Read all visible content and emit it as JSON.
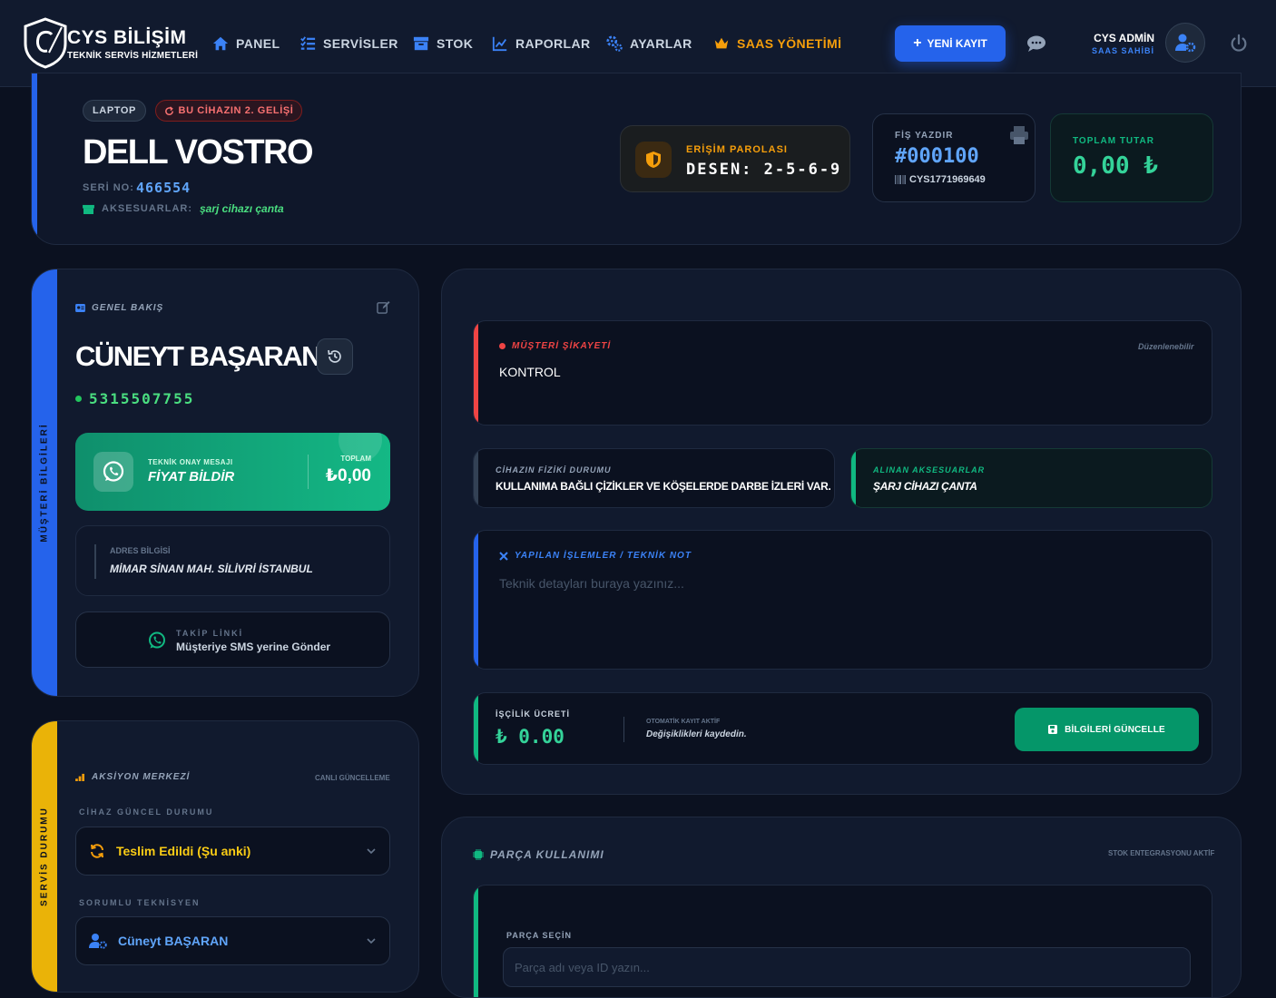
{
  "colors": {
    "primary": "#2563eb",
    "success": "#10b981",
    "warning": "#f59e0b",
    "danger": "#ef4444",
    "background": "#0b1120"
  },
  "brand": {
    "title": "CYS BİLİŞİM",
    "subtitle": "TEKNİK SERVİS HİZMETLERİ"
  },
  "nav": {
    "items": [
      {
        "label": "PANEL",
        "icon": "home-icon"
      },
      {
        "label": "SERVİSLER",
        "icon": "list-check-icon"
      },
      {
        "label": "STOK",
        "icon": "archive-icon"
      },
      {
        "label": "RAPORLAR",
        "icon": "chart-line-icon"
      },
      {
        "label": "AYARLAR",
        "icon": "gears-icon"
      },
      {
        "label": "SAAS YÖNETİMİ",
        "icon": "crown-icon"
      }
    ],
    "new_button": "YENİ KAYIT"
  },
  "user": {
    "name": "CYS ADMİN",
    "role": "SAAS SAHİBİ"
  },
  "device": {
    "type_badge": "LAPTOP",
    "visit_badge": "BU CİHAZIN 2. GELİŞİ",
    "title": "DELL VOSTRO",
    "serial_label": "SERİ NO:",
    "serial": "466554",
    "accessories_label": "AKSESUARLAR:",
    "accessories": "şarj cihazı çanta"
  },
  "access": {
    "label": "ERİŞİM PAROLASI",
    "value": "DESEN: 2-5-6-9"
  },
  "receipt": {
    "label": "FİŞ YAZDIR",
    "number": "#000100",
    "code": "CYS1771969649"
  },
  "total": {
    "label": "TOPLAM TUTAR",
    "value": "0,00 ₺"
  },
  "customer": {
    "side_label": "MÜŞTERİ BİLGİLERİ",
    "section_title": "GENEL BAKIŞ",
    "name": "CÜNEYT BAŞARAN",
    "phone": "5315507755",
    "whatsapp": {
      "small": "TEKNİK ONAY MESAJI",
      "big": "FİYAT BİLDİR",
      "total_label": "TOPLAM",
      "total": "₺0,00"
    },
    "address_label": "ADRES BİLGİSİ",
    "address": "MİMAR SİNAN MAH. SİLİVRİ İSTANBUL",
    "link_label": "TAKİP LİNKİ",
    "link_text": "Müşteriye SMS yerine Gönder"
  },
  "action": {
    "side_label": "SERVİS DURUMU",
    "title": "AKSİYON MERKEZİ",
    "live": "CANLI GÜNCELLEME",
    "status_label": "CİHAZ GÜNCEL DURUMU",
    "status": "Teslim Edildi (Şu anki)",
    "tech_label": "SORUMLU TEKNİSYEN",
    "technician": "Cüneyt BAŞARAN"
  },
  "complaint": {
    "label": "MÜŞTERİ ŞİKAYETİ",
    "editable": "Düzenlenebilir",
    "text": "KONTROL"
  },
  "condition": {
    "label": "CİHAZIN FİZİKİ DURUMU",
    "value": "KULLANIMA BAĞLI ÇİZİKLER VE KÖŞELERDE DARBE İZLERİ VAR."
  },
  "received_accessories": {
    "label": "ALINAN AKSESUARLAR",
    "value": "ŞARJ CİHAZI ÇANTA"
  },
  "notes": {
    "label": "YAPILAN İŞLEMLER / TEKNİK NOT",
    "placeholder": "Teknik detayları buraya yazınız..."
  },
  "labor": {
    "label": "İŞÇİLİK ÜCRETİ",
    "value": "₺ 0.00",
    "auto_small": "OTOMATİK KAYIT AKTİF",
    "auto_big": "Değişiklikleri kaydedin.",
    "button": "BİLGİLERİ GÜNCELLE"
  },
  "parts": {
    "title": "PARÇA KULLANIMI",
    "stock": "STOK ENTEGRASYONU AKTİF",
    "select_label": "PARÇA SEÇİN",
    "placeholder": "Parça adı veya ID yazın..."
  }
}
